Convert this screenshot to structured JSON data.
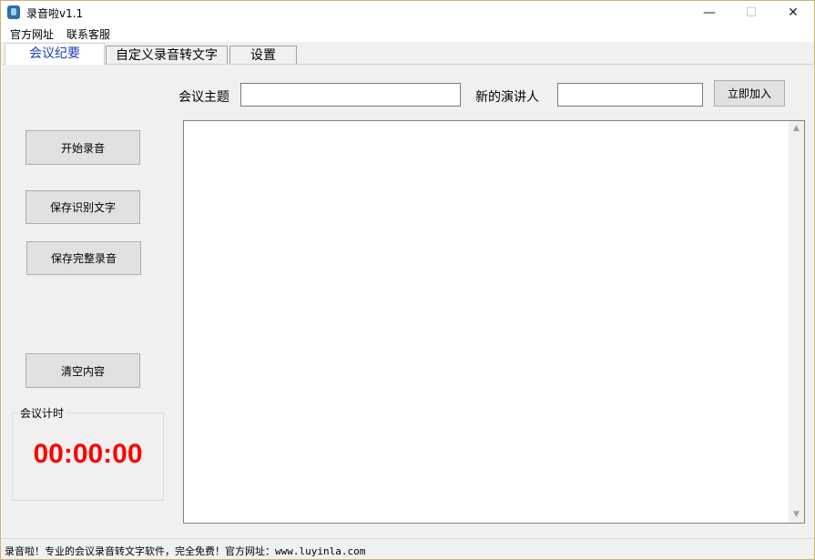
{
  "window": {
    "title": "录音啦v1.1",
    "minimize_glyph": "—",
    "maximize_glyph": "☐",
    "close_glyph": "✕"
  },
  "menu": {
    "items": [
      {
        "label": "官方网址"
      },
      {
        "label": "联系客服"
      }
    ]
  },
  "tabs": [
    {
      "label": "会议纪要",
      "active": true
    },
    {
      "label": "自定义录音转文字",
      "active": false
    },
    {
      "label": "设置",
      "active": false
    }
  ],
  "meeting": {
    "topic_label": "会议主题",
    "topic_value": "",
    "speaker_label": "新的演讲人",
    "speaker_value": "",
    "join_button": "立即加入",
    "transcript": ""
  },
  "actions": {
    "start_recording": "开始录音",
    "save_text": "保存识别文字",
    "save_audio": "保存完整录音",
    "clear_content": "清空内容"
  },
  "timer": {
    "title": "会议计时",
    "value": "00:00:00",
    "color": "#ff0000"
  },
  "status": {
    "text": "录音啦！专业的会议录音转文字软件，完全免费！官方网址：www.luyinla.com"
  },
  "icons": {
    "app": "app-icon",
    "scroll_up": "chevron-up-icon",
    "scroll_down": "chevron-down-icon"
  },
  "colors": {
    "active_tab_text": "#1b3fb5",
    "panel_bg": "#f0f0f0"
  }
}
